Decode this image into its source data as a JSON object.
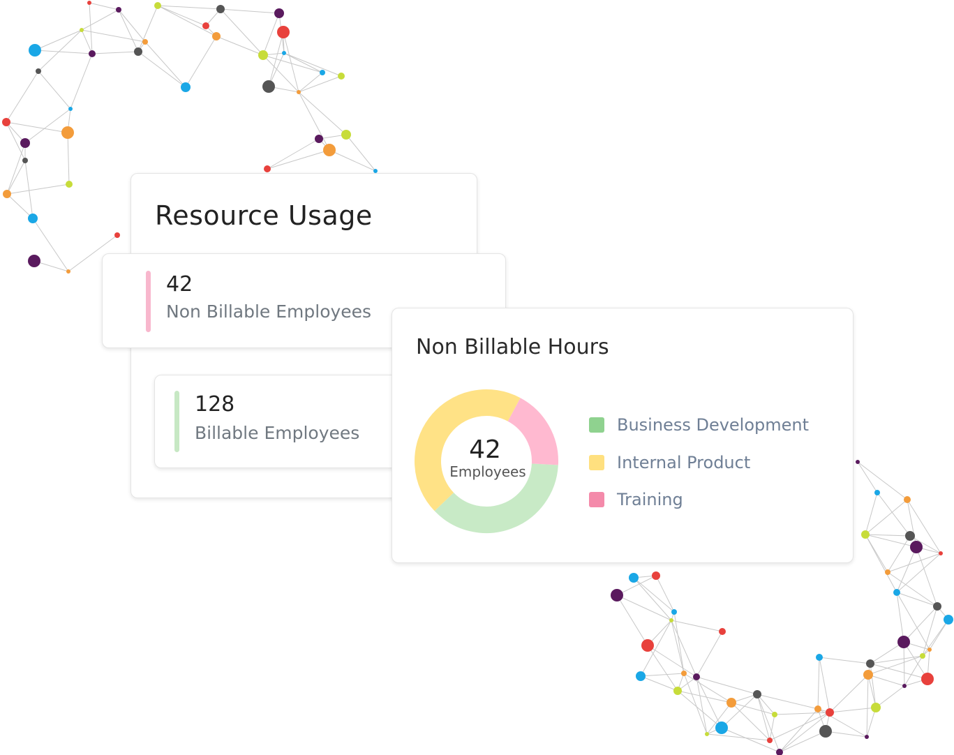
{
  "resource_usage": {
    "title": "Resource Usage"
  },
  "non_billable": {
    "count": "42",
    "label": "Non Billable Employees",
    "color": "#f8b7cd"
  },
  "billable": {
    "count": "128",
    "label": "Billable Employees",
    "color": "#c7e8c4"
  },
  "hours": {
    "title": "Non Billable Hours",
    "center_value": "42",
    "center_label": "Employees",
    "legend": [
      {
        "label": "Business Development",
        "color": "#8fd28f"
      },
      {
        "label": "Internal Product",
        "color": "#ffe07f"
      },
      {
        "label": "Training",
        "color": "#f48aaa"
      }
    ]
  },
  "chart_data": {
    "type": "pie",
    "categories": [
      "Business Development",
      "Internal Product",
      "Training"
    ],
    "values": [
      37,
      45,
      18
    ],
    "colors": [
      "#c8eac6",
      "#ffe286",
      "#ffb9d0"
    ]
  }
}
